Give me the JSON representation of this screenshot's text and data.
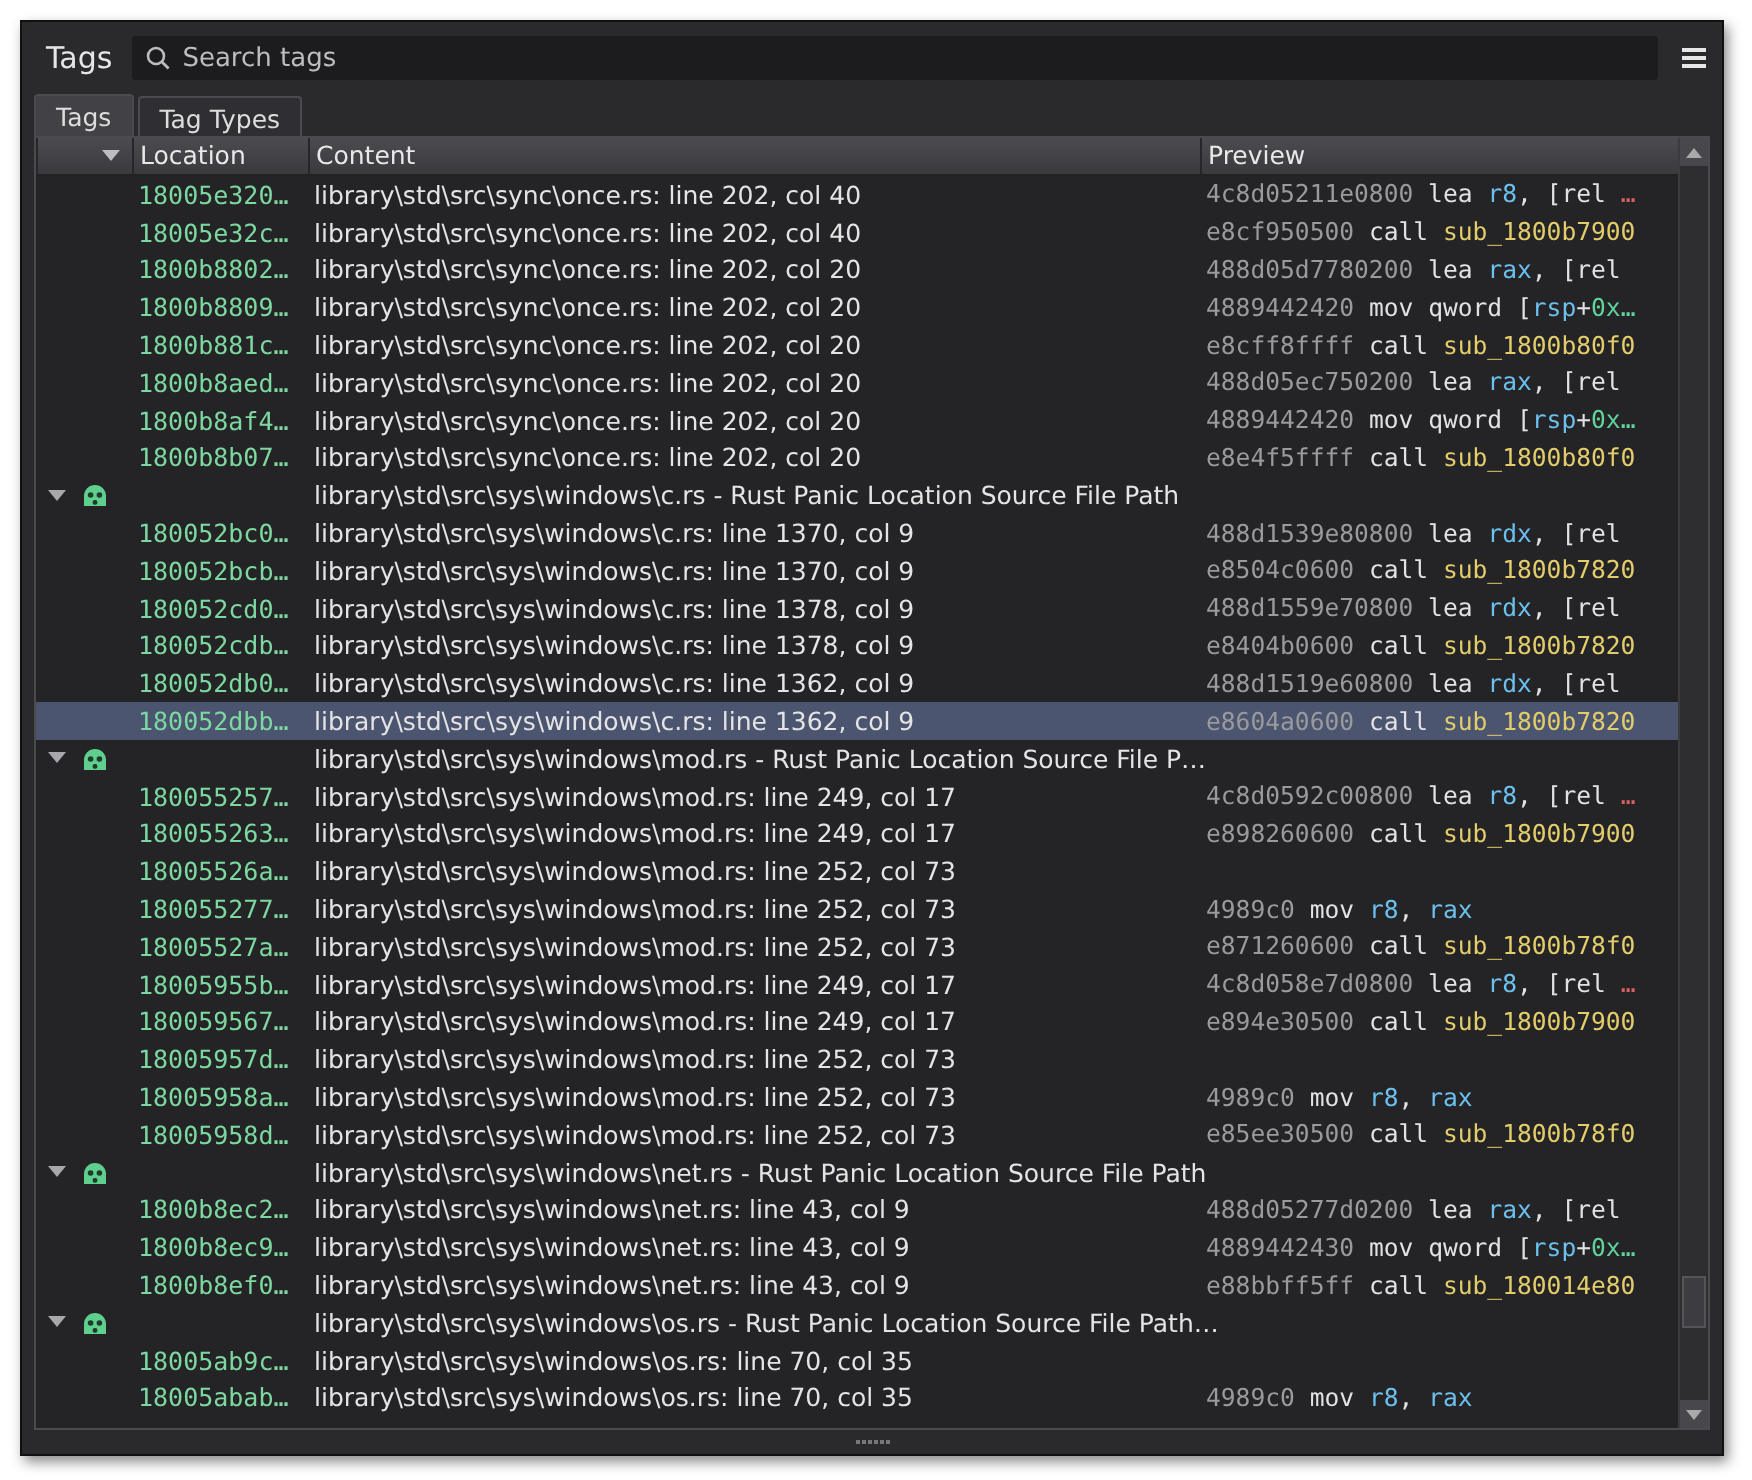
{
  "panel": {
    "title": "Tags"
  },
  "search": {
    "placeholder": "Search tags"
  },
  "tabs": [
    {
      "label": "Tags",
      "selected": true
    },
    {
      "label": "Tag Types",
      "selected": false
    }
  ],
  "columns": [
    "Location",
    "Content",
    "Preview"
  ],
  "rows": [
    {
      "kind": "item",
      "selected": false,
      "location": "18005e320…",
      "content": "library\\std\\src\\sync\\once.rs: line 202, col 40",
      "preview": [
        {
          "text": "4c8d05211e0800",
          "kind": "bytes"
        },
        {
          "text": " lea ",
          "kind": "op"
        },
        {
          "text": "r8",
          "kind": "reg"
        },
        {
          "text": ", [rel ",
          "kind": "op"
        },
        {
          "text": "…",
          "kind": "more"
        }
      ]
    },
    {
      "kind": "item",
      "selected": false,
      "location": "18005e32c…",
      "content": "library\\std\\src\\sync\\once.rs: line 202, col 40",
      "preview": [
        {
          "text": "e8cf950500",
          "kind": "bytes"
        },
        {
          "text": " call ",
          "kind": "op"
        },
        {
          "text": "sub_1800b7900",
          "kind": "sym"
        }
      ]
    },
    {
      "kind": "item",
      "selected": false,
      "location": "1800b8802…",
      "content": "library\\std\\src\\sync\\once.rs: line 202, col 20",
      "preview": [
        {
          "text": "488d05d7780200",
          "kind": "bytes"
        },
        {
          "text": " lea ",
          "kind": "op"
        },
        {
          "text": "rax",
          "kind": "reg"
        },
        {
          "text": ", [rel",
          "kind": "op"
        }
      ]
    },
    {
      "kind": "item",
      "selected": false,
      "location": "1800b8809…",
      "content": "library\\std\\src\\sync\\once.rs: line 202, col 20",
      "preview": [
        {
          "text": "4889442420",
          "kind": "bytes"
        },
        {
          "text": " mov qword [",
          "kind": "op"
        },
        {
          "text": "rsp",
          "kind": "reg"
        },
        {
          "text": "+",
          "kind": "op"
        },
        {
          "text": "0x…",
          "kind": "num"
        }
      ]
    },
    {
      "kind": "item",
      "selected": false,
      "location": "1800b881c…",
      "content": "library\\std\\src\\sync\\once.rs: line 202, col 20",
      "preview": [
        {
          "text": "e8cff8ffff",
          "kind": "bytes"
        },
        {
          "text": " call ",
          "kind": "op"
        },
        {
          "text": "sub_1800b80f0",
          "kind": "sym"
        }
      ]
    },
    {
      "kind": "item",
      "selected": false,
      "location": "1800b8aed…",
      "content": "library\\std\\src\\sync\\once.rs: line 202, col 20",
      "preview": [
        {
          "text": "488d05ec750200",
          "kind": "bytes"
        },
        {
          "text": " lea ",
          "kind": "op"
        },
        {
          "text": "rax",
          "kind": "reg"
        },
        {
          "text": ", [rel",
          "kind": "op"
        }
      ]
    },
    {
      "kind": "item",
      "selected": false,
      "location": "1800b8af4…",
      "content": "library\\std\\src\\sync\\once.rs: line 202, col 20",
      "preview": [
        {
          "text": "4889442420",
          "kind": "bytes"
        },
        {
          "text": " mov qword [",
          "kind": "op"
        },
        {
          "text": "rsp",
          "kind": "reg"
        },
        {
          "text": "+",
          "kind": "op"
        },
        {
          "text": "0x…",
          "kind": "num"
        }
      ]
    },
    {
      "kind": "item",
      "selected": false,
      "location": "1800b8b07…",
      "content": "library\\std\\src\\sync\\once.rs: line 202, col 20",
      "preview": [
        {
          "text": "e8e4f5ffff",
          "kind": "bytes"
        },
        {
          "text": " call ",
          "kind": "op"
        },
        {
          "text": "sub_1800b80f0",
          "kind": "sym"
        }
      ]
    },
    {
      "kind": "group",
      "selected": false,
      "expanded": true,
      "content": "library\\std\\src\\sys\\windows\\c.rs - Rust Panic Location Source File Path",
      "children": [
        {
          "kind": "item",
          "selected": false,
          "location": "180052bc0…",
          "content": "library\\std\\src\\sys\\windows\\c.rs: line 1370, col 9",
          "preview": [
            {
              "text": "488d1539e80800",
              "kind": "bytes"
            },
            {
              "text": " lea ",
              "kind": "op"
            },
            {
              "text": "rdx",
              "kind": "reg"
            },
            {
              "text": ", [rel",
              "kind": "op"
            }
          ]
        },
        {
          "kind": "item",
          "selected": false,
          "location": "180052bcb…",
          "content": "library\\std\\src\\sys\\windows\\c.rs: line 1370, col 9",
          "preview": [
            {
              "text": "e8504c0600",
              "kind": "bytes"
            },
            {
              "text": " call ",
              "kind": "op"
            },
            {
              "text": "sub_1800b7820",
              "kind": "sym"
            }
          ]
        },
        {
          "kind": "item",
          "selected": false,
          "location": "180052cd0…",
          "content": "library\\std\\src\\sys\\windows\\c.rs: line 1378, col 9",
          "preview": [
            {
              "text": "488d1559e70800",
              "kind": "bytes"
            },
            {
              "text": " lea ",
              "kind": "op"
            },
            {
              "text": "rdx",
              "kind": "reg"
            },
            {
              "text": ", [rel",
              "kind": "op"
            }
          ]
        },
        {
          "kind": "item",
          "selected": false,
          "location": "180052cdb…",
          "content": "library\\std\\src\\sys\\windows\\c.rs: line 1378, col 9",
          "preview": [
            {
              "text": "e8404b0600",
              "kind": "bytes"
            },
            {
              "text": " call ",
              "kind": "op"
            },
            {
              "text": "sub_1800b7820",
              "kind": "sym"
            }
          ]
        },
        {
          "kind": "item",
          "selected": false,
          "location": "180052db0…",
          "content": "library\\std\\src\\sys\\windows\\c.rs: line 1362, col 9",
          "preview": [
            {
              "text": "488d1519e60800",
              "kind": "bytes"
            },
            {
              "text": " lea ",
              "kind": "op"
            },
            {
              "text": "rdx",
              "kind": "reg"
            },
            {
              "text": ", [rel",
              "kind": "op"
            }
          ]
        },
        {
          "kind": "item",
          "selected": true,
          "location": "180052dbb…",
          "content": "library\\std\\src\\sys\\windows\\c.rs: line 1362, col 9",
          "preview": [
            {
              "text": "e8604a0600",
              "kind": "bytes"
            },
            {
              "text": " call ",
              "kind": "op"
            },
            {
              "text": "sub_1800b7820",
              "kind": "sym"
            }
          ]
        }
      ]
    },
    {
      "kind": "group",
      "selected": false,
      "expanded": true,
      "content": "library\\std\\src\\sys\\windows\\mod.rs - Rust Panic Location Source File P…",
      "children": [
        {
          "kind": "item",
          "selected": false,
          "location": "180055257…",
          "content": "library\\std\\src\\sys\\windows\\mod.rs: line 249, col 17",
          "preview": [
            {
              "text": "4c8d0592c00800",
              "kind": "bytes"
            },
            {
              "text": " lea ",
              "kind": "op"
            },
            {
              "text": "r8",
              "kind": "reg"
            },
            {
              "text": ", [rel ",
              "kind": "op"
            },
            {
              "text": "…",
              "kind": "more"
            }
          ]
        },
        {
          "kind": "item",
          "selected": false,
          "location": "180055263…",
          "content": "library\\std\\src\\sys\\windows\\mod.rs: line 249, col 17",
          "preview": [
            {
              "text": "e898260600",
              "kind": "bytes"
            },
            {
              "text": " call ",
              "kind": "op"
            },
            {
              "text": "sub_1800b7900",
              "kind": "sym"
            }
          ]
        },
        {
          "kind": "item",
          "selected": false,
          "location": "18005526a…",
          "content": "library\\std\\src\\sys\\windows\\mod.rs: line 252, col 73"
        },
        {
          "kind": "item",
          "selected": false,
          "location": "180055277…",
          "content": "library\\std\\src\\sys\\windows\\mod.rs: line 252, col 73",
          "preview": [
            {
              "text": "4989c0",
              "kind": "bytes"
            },
            {
              "text": " mov ",
              "kind": "op"
            },
            {
              "text": "r8",
              "kind": "reg"
            },
            {
              "text": ", ",
              "kind": "op"
            },
            {
              "text": "rax",
              "kind": "reg"
            }
          ]
        },
        {
          "kind": "item",
          "selected": false,
          "location": "18005527a…",
          "content": "library\\std\\src\\sys\\windows\\mod.rs: line 252, col 73",
          "preview": [
            {
              "text": "e871260600",
              "kind": "bytes"
            },
            {
              "text": " call ",
              "kind": "op"
            },
            {
              "text": "sub_1800b78f0",
              "kind": "sym"
            }
          ]
        },
        {
          "kind": "item",
          "selected": false,
          "location": "18005955b…",
          "content": "library\\std\\src\\sys\\windows\\mod.rs: line 249, col 17",
          "preview": [
            {
              "text": "4c8d058e7d0800",
              "kind": "bytes"
            },
            {
              "text": " lea ",
              "kind": "op"
            },
            {
              "text": "r8",
              "kind": "reg"
            },
            {
              "text": ", [rel ",
              "kind": "op"
            },
            {
              "text": "…",
              "kind": "more"
            }
          ]
        },
        {
          "kind": "item",
          "selected": false,
          "location": "180059567…",
          "content": "library\\std\\src\\sys\\windows\\mod.rs: line 249, col 17",
          "preview": [
            {
              "text": "e894e30500",
              "kind": "bytes"
            },
            {
              "text": " call ",
              "kind": "op"
            },
            {
              "text": "sub_1800b7900",
              "kind": "sym"
            }
          ]
        },
        {
          "kind": "item",
          "selected": false,
          "location": "18005957d…",
          "content": "library\\std\\src\\sys\\windows\\mod.rs: line 252, col 73"
        },
        {
          "kind": "item",
          "selected": false,
          "location": "18005958a…",
          "content": "library\\std\\src\\sys\\windows\\mod.rs: line 252, col 73",
          "preview": [
            {
              "text": "4989c0",
              "kind": "bytes"
            },
            {
              "text": " mov ",
              "kind": "op"
            },
            {
              "text": "r8",
              "kind": "reg"
            },
            {
              "text": ", ",
              "kind": "op"
            },
            {
              "text": "rax",
              "kind": "reg"
            }
          ]
        },
        {
          "kind": "item",
          "selected": false,
          "location": "18005958d…",
          "content": "library\\std\\src\\sys\\windows\\mod.rs: line 252, col 73",
          "preview": [
            {
              "text": "e85ee30500",
              "kind": "bytes"
            },
            {
              "text": " call ",
              "kind": "op"
            },
            {
              "text": "sub_1800b78f0",
              "kind": "sym"
            }
          ]
        }
      ]
    },
    {
      "kind": "group",
      "selected": false,
      "expanded": true,
      "content": "library\\std\\src\\sys\\windows\\net.rs - Rust Panic Location Source File Path",
      "children": [
        {
          "kind": "item",
          "selected": false,
          "location": "1800b8ec2…",
          "content": "library\\std\\src\\sys\\windows\\net.rs: line 43, col 9",
          "preview": [
            {
              "text": "488d05277d0200",
              "kind": "bytes"
            },
            {
              "text": " lea ",
              "kind": "op"
            },
            {
              "text": "rax",
              "kind": "reg"
            },
            {
              "text": ", [rel",
              "kind": "op"
            }
          ]
        },
        {
          "kind": "item",
          "selected": false,
          "location": "1800b8ec9…",
          "content": "library\\std\\src\\sys\\windows\\net.rs: line 43, col 9",
          "preview": [
            {
              "text": "4889442430",
              "kind": "bytes"
            },
            {
              "text": " mov qword [",
              "kind": "op"
            },
            {
              "text": "rsp",
              "kind": "reg"
            },
            {
              "text": "+",
              "kind": "op"
            },
            {
              "text": "0x…",
              "kind": "num"
            }
          ]
        },
        {
          "kind": "item",
          "selected": false,
          "location": "1800b8ef0…",
          "content": "library\\std\\src\\sys\\windows\\net.rs: line 43, col 9",
          "preview": [
            {
              "text": "e88bbff5ff",
              "kind": "bytes"
            },
            {
              "text": " call ",
              "kind": "op"
            },
            {
              "text": "sub_180014e80",
              "kind": "sym"
            }
          ]
        }
      ]
    },
    {
      "kind": "group",
      "selected": false,
      "expanded": true,
      "content": "library\\std\\src\\sys\\windows\\os.rs - Rust Panic Location Source File Path…",
      "children": [
        {
          "kind": "item",
          "selected": false,
          "location": "18005ab9c…",
          "content": "library\\std\\src\\sys\\windows\\os.rs: line 70, col 35"
        },
        {
          "kind": "item",
          "selected": false,
          "location": "18005abab…",
          "content": "library\\std\\src\\sys\\windows\\os.rs: line 70, col 35",
          "preview": [
            {
              "text": "4989c0",
              "kind": "bytes"
            },
            {
              "text": " mov ",
              "kind": "op"
            },
            {
              "text": "r8",
              "kind": "reg"
            },
            {
              "text": ", ",
              "kind": "op"
            },
            {
              "text": "rax",
              "kind": "reg"
            }
          ]
        }
      ]
    }
  ]
}
